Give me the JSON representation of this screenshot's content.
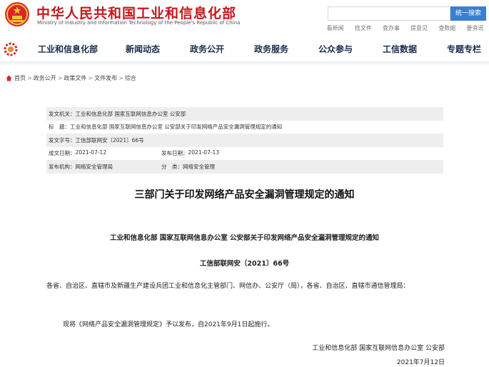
{
  "header": {
    "title": "中华人民共和国工业和信息化部",
    "subtitle": "Ministry of Industry and Information Technology of the People's Republic of China",
    "search_placeholder": "",
    "search_button": "统一搜索",
    "quick_links": [
      "看新闻",
      "找文件",
      "查办事",
      "提意见",
      "查数据",
      "要资讯"
    ],
    "brand_color": "#c8161d"
  },
  "nav": {
    "items": [
      "工业和信息化部",
      "新闻动态",
      "政务公开",
      "政务服务",
      "公众参与",
      "工信数据",
      "专题专栏"
    ]
  },
  "breadcrumb": {
    "items": [
      "首页",
      "政务公开",
      "政策文件",
      "文件发布",
      "综合"
    ],
    "separator": ">"
  },
  "meta": {
    "issuer_label": "发文机关：",
    "issuer": "工业和信息化部  国家互联网信息办公室  公安部",
    "title_label": "标　题：",
    "title": "工业和信息化部 国家互联网信息办公室 公安部关于印发网络产品安全漏洞管理规定的通知",
    "docno_label": "发文字号：",
    "docno": "工信部联网安〔2021〕66号",
    "created_label": "成文日期：",
    "created": "2021-07-12",
    "published_label": "发布日期：",
    "published": "2021-07-13",
    "org_label": "发布机构：",
    "org": "网络安全管理局",
    "category_label": "分　类：",
    "category": "网络安全管理"
  },
  "document": {
    "title": "三部门关于印发网络产品安全漏洞管理规定的通知",
    "subtitle": "工业和信息化部  国家互联网信息办公室  公安部关于印发网络产品安全漏洞管理规定的通知",
    "number": "工信部联网安〔2021〕66号",
    "para1": "各省、自治区、直辖市及新疆生产建设兵团工业和信息化主管部门、网信办、公安厅（局），各省、自治区、直辖市通信管理局：",
    "para2": "现将《网络产品安全漏洞管理规定》予以发布，自2021年9月1日起施行。",
    "signature": "工业和信息化部  国家互联网信息办公室  公安部",
    "date": "2021年7月12日"
  }
}
